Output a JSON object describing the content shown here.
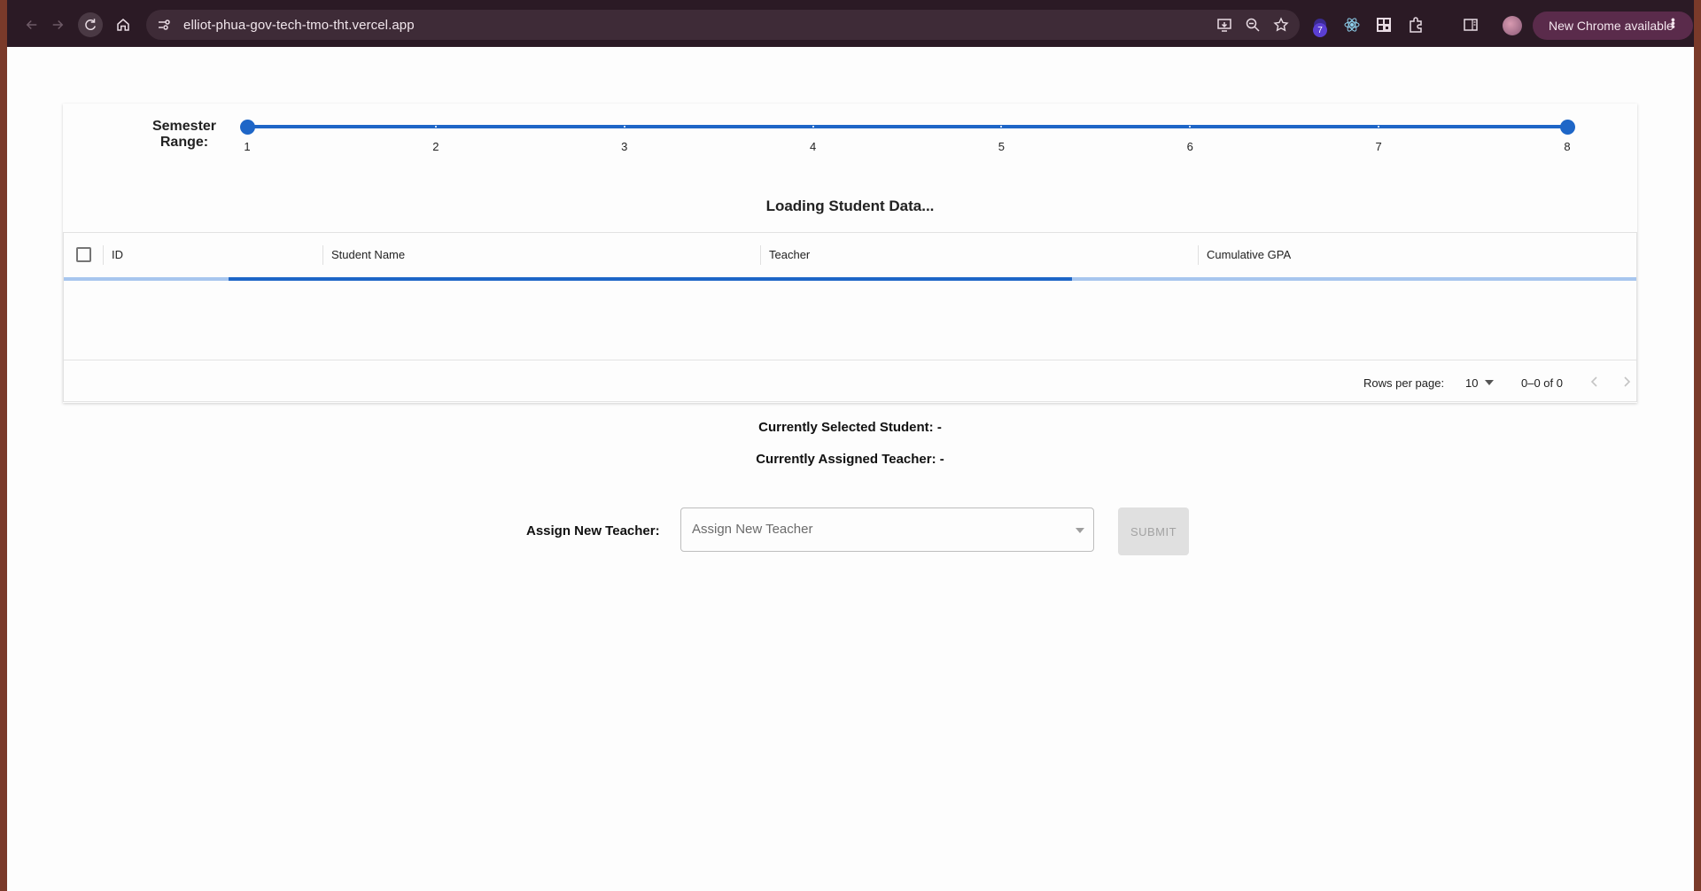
{
  "browser": {
    "url": "elliot-phua-gov-tech-tmo-tht.vercel.app",
    "extension_badge": "7",
    "update_button": "New Chrome available"
  },
  "slider": {
    "label": "Semester Range:",
    "ticks": [
      "1",
      "2",
      "3",
      "4",
      "5",
      "6",
      "7",
      "8"
    ],
    "range_start": 1,
    "range_end": 8,
    "accent_color": "#1e66c7"
  },
  "table": {
    "loading_title": "Loading Student Data...",
    "columns": [
      "ID",
      "Student Name",
      "Teacher",
      "Cumulative GPA"
    ],
    "rows_per_page_label": "Rows per page:",
    "rows_per_page_value": "10",
    "pagination_info": "0–0 of 0"
  },
  "selection": {
    "student_line": "Currently Selected Student: -",
    "teacher_line": "Currently Assigned Teacher: -"
  },
  "assign": {
    "label": "Assign New Teacher:",
    "placeholder": "Assign New Teacher",
    "submit_label": "SUBMIT"
  }
}
